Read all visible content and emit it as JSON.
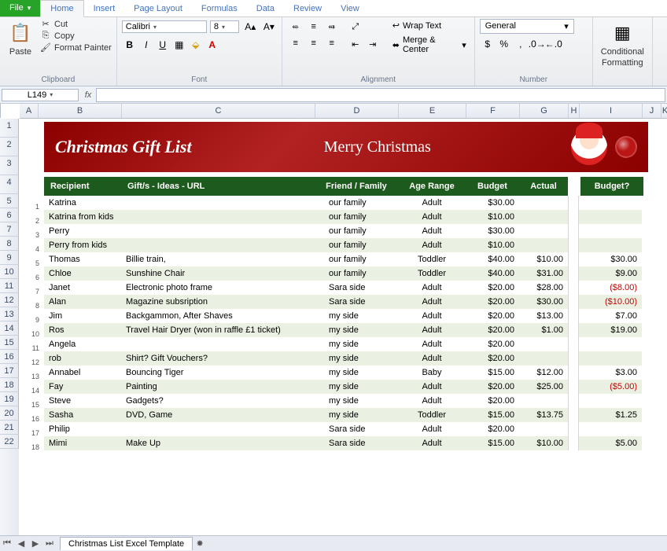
{
  "tabs": [
    "File",
    "Home",
    "Insert",
    "Page Layout",
    "Formulas",
    "Data",
    "Review",
    "View"
  ],
  "active_tab": "Home",
  "ribbon": {
    "clipboard": {
      "label": "Clipboard",
      "paste": "Paste",
      "cut": "Cut",
      "copy": "Copy",
      "format_painter": "Format Painter"
    },
    "font": {
      "label": "Font",
      "family": "Calibri",
      "size": "8"
    },
    "alignment": {
      "label": "Alignment",
      "wrap": "Wrap Text",
      "merge": "Merge & Center"
    },
    "number": {
      "label": "Number",
      "format": "General"
    },
    "styles": {
      "conditional": "Conditional",
      "formatting": "Formatting"
    }
  },
  "name_box": "L149",
  "columns": [
    "A",
    "B",
    "C",
    "D",
    "E",
    "F",
    "G",
    "H",
    "I",
    "J",
    "K"
  ],
  "row_numbers": [
    1,
    2,
    3,
    4,
    5,
    6,
    7,
    8,
    9,
    10,
    11,
    12,
    13,
    14,
    15,
    16,
    17,
    18,
    19,
    20,
    21,
    22
  ],
  "banner": {
    "title": "Christmas Gift List",
    "merry": "Merry Christmas"
  },
  "headers": {
    "recipient": "Recipient",
    "gifts": "Gift/s - Ideas - URL",
    "friend_family": "Friend / Family",
    "age": "Age Range",
    "budget": "Budget",
    "actual": "Actual",
    "over": "Budget?"
  },
  "rows": [
    {
      "n": 1,
      "recipient": "Katrina",
      "gift": "",
      "ff": "our family",
      "age": "Adult",
      "budget": "$30.00",
      "actual": "",
      "over": ""
    },
    {
      "n": 2,
      "recipient": "Katrina from kids",
      "gift": "",
      "ff": "our family",
      "age": "Adult",
      "budget": "$10.00",
      "actual": "",
      "over": ""
    },
    {
      "n": 3,
      "recipient": "Perry",
      "gift": "",
      "ff": "our family",
      "age": "Adult",
      "budget": "$30.00",
      "actual": "",
      "over": ""
    },
    {
      "n": 4,
      "recipient": "Perry from kids",
      "gift": "",
      "ff": "our family",
      "age": "Adult",
      "budget": "$10.00",
      "actual": "",
      "over": ""
    },
    {
      "n": 5,
      "recipient": "Thomas",
      "gift": "Billie train,",
      "ff": "our family",
      "age": "Toddler",
      "budget": "$40.00",
      "actual": "$10.00",
      "over": "$30.00"
    },
    {
      "n": 6,
      "recipient": "Chloe",
      "gift": "Sunshine Chair",
      "ff": "our family",
      "age": "Toddler",
      "budget": "$40.00",
      "actual": "$31.00",
      "over": "$9.00"
    },
    {
      "n": 7,
      "recipient": "Janet",
      "gift": "Electronic photo frame",
      "ff": "Sara side",
      "age": "Adult",
      "budget": "$20.00",
      "actual": "$28.00",
      "over": "($8.00)",
      "neg": true
    },
    {
      "n": 8,
      "recipient": "Alan",
      "gift": "Magazine subsription",
      "ff": "Sara side",
      "age": "Adult",
      "budget": "$20.00",
      "actual": "$30.00",
      "over": "($10.00)",
      "neg": true
    },
    {
      "n": 9,
      "recipient": "Jim",
      "gift": "Backgammon, After Shaves",
      "ff": "my side",
      "age": "Adult",
      "budget": "$20.00",
      "actual": "$13.00",
      "over": "$7.00"
    },
    {
      "n": 10,
      "recipient": "Ros",
      "gift": "Travel Hair Dryer (won in raffle £1 ticket)",
      "ff": "my side",
      "age": "Adult",
      "budget": "$20.00",
      "actual": "$1.00",
      "over": "$19.00"
    },
    {
      "n": 11,
      "recipient": "Angela",
      "gift": "",
      "ff": "my side",
      "age": "Adult",
      "budget": "$20.00",
      "actual": "",
      "over": ""
    },
    {
      "n": 12,
      "recipient": "rob",
      "gift": "Shirt? Gift Vouchers?",
      "ff": "my side",
      "age": "Adult",
      "budget": "$20.00",
      "actual": "",
      "over": ""
    },
    {
      "n": 13,
      "recipient": "Annabel",
      "gift": "Bouncing Tiger",
      "ff": "my side",
      "age": "Baby",
      "budget": "$15.00",
      "actual": "$12.00",
      "over": "$3.00"
    },
    {
      "n": 14,
      "recipient": "Fay",
      "gift": "Painting",
      "ff": "my side",
      "age": "Adult",
      "budget": "$20.00",
      "actual": "$25.00",
      "over": "($5.00)",
      "neg": true
    },
    {
      "n": 15,
      "recipient": "Steve",
      "gift": "Gadgets?",
      "ff": "my side",
      "age": "Adult",
      "budget": "$20.00",
      "actual": "",
      "over": ""
    },
    {
      "n": 16,
      "recipient": "Sasha",
      "gift": "DVD, Game",
      "ff": "my side",
      "age": "Toddler",
      "budget": "$15.00",
      "actual": "$13.75",
      "over": "$1.25"
    },
    {
      "n": 17,
      "recipient": "Philip",
      "gift": "",
      "ff": "Sara side",
      "age": "Adult",
      "budget": "$20.00",
      "actual": "",
      "over": ""
    },
    {
      "n": 18,
      "recipient": "Mimi",
      "gift": "Make Up",
      "ff": "Sara side",
      "age": "Adult",
      "budget": "$15.00",
      "actual": "$10.00",
      "over": "$5.00"
    }
  ],
  "sheet_tab": "Christmas List Excel Template"
}
